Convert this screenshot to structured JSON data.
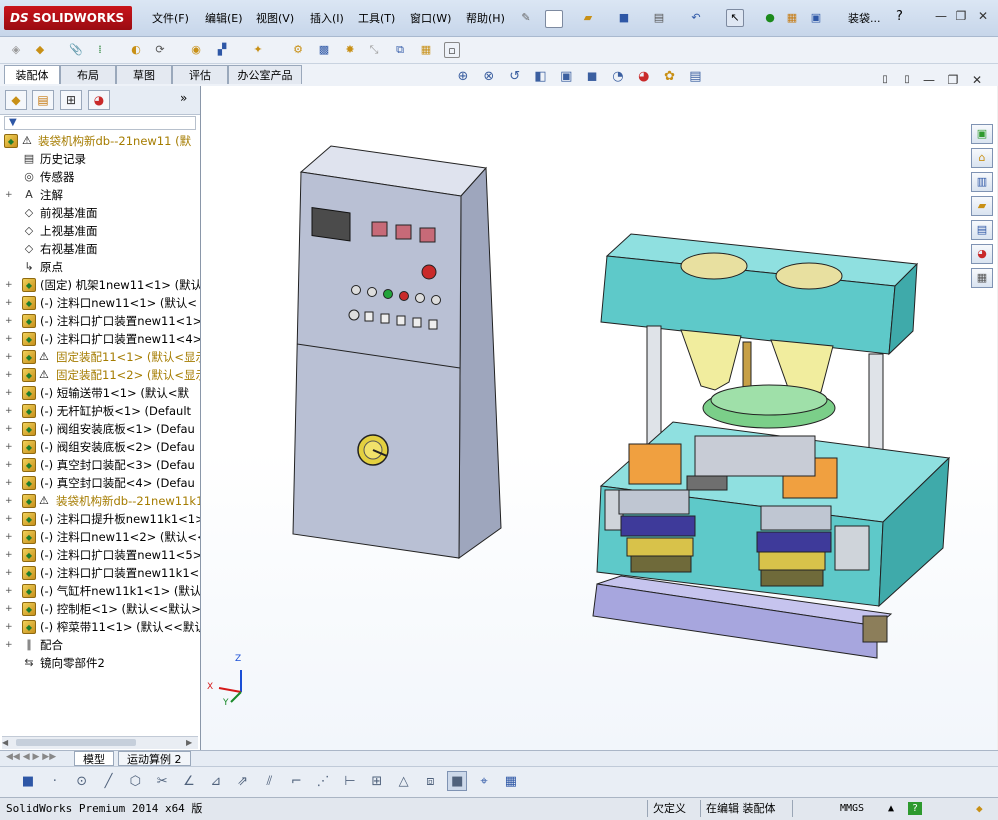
{
  "app": {
    "logo_brand": "SOLIDWORKS",
    "logo_ds": "DS",
    "doc_title": "装袋...",
    "help": "?"
  },
  "menu": [
    "文件(F)",
    "编辑(E)",
    "视图(V)",
    "插入(I)",
    "工具(T)",
    "窗口(W)",
    "帮助(H)"
  ],
  "command_tabs": [
    "装配体",
    "布局",
    "草图",
    "评估",
    "办公室产品"
  ],
  "feature_tree": {
    "filter_icon": "filter-icon",
    "rows": [
      {
        "label": "装袋机构新db--21new11  (默",
        "icon": "assembly-icon",
        "warn": true,
        "style": "yellow",
        "expand": false,
        "indent": 0
      },
      {
        "label": "历史记录",
        "icon": "history-icon",
        "warn": false,
        "style": "normal",
        "expand": false,
        "indent": 1
      },
      {
        "label": "传感器",
        "icon": "sensor-icon",
        "warn": false,
        "style": "normal",
        "expand": false,
        "indent": 1
      },
      {
        "label": "注解",
        "icon": "annotation-icon",
        "warn": false,
        "style": "normal",
        "expand": true,
        "indent": 1
      },
      {
        "label": "前视基准面",
        "icon": "plane-icon",
        "warn": false,
        "style": "normal",
        "expand": false,
        "indent": 1
      },
      {
        "label": "上视基准面",
        "icon": "plane-icon",
        "warn": false,
        "style": "normal",
        "expand": false,
        "indent": 1
      },
      {
        "label": "右视基准面",
        "icon": "plane-icon",
        "warn": false,
        "style": "normal",
        "expand": false,
        "indent": 1
      },
      {
        "label": "原点",
        "icon": "origin-icon",
        "warn": false,
        "style": "normal",
        "expand": false,
        "indent": 1
      },
      {
        "label": "(固定) 机架1new11<1> (默认",
        "icon": "part-icon",
        "warn": false,
        "style": "normal",
        "expand": true,
        "indent": 1
      },
      {
        "label": "(-) 注料口new11<1> (默认<",
        "icon": "part-icon",
        "warn": false,
        "style": "normal",
        "expand": true,
        "indent": 1
      },
      {
        "label": "(-) 注料口扩口装置new11<1>",
        "icon": "part-icon",
        "warn": false,
        "style": "normal",
        "expand": true,
        "indent": 1
      },
      {
        "label": "(-) 注料口扩口装置new11<4>",
        "icon": "part-icon",
        "warn": false,
        "style": "normal",
        "expand": true,
        "indent": 1
      },
      {
        "label": "固定装配11<1> (默认<显示",
        "icon": "assembly-icon",
        "warn": true,
        "style": "yellow",
        "expand": true,
        "indent": 1
      },
      {
        "label": "固定装配11<2> (默认<显示",
        "icon": "assembly-icon",
        "warn": true,
        "style": "yellow",
        "expand": true,
        "indent": 1
      },
      {
        "label": "(-) 短输送带1<1> (默认<默",
        "icon": "part-icon",
        "warn": false,
        "style": "normal",
        "expand": true,
        "indent": 1
      },
      {
        "label": "(-) 无杆缸护板<1> (Default",
        "icon": "part-icon",
        "warn": false,
        "style": "normal",
        "expand": true,
        "indent": 1
      },
      {
        "label": "(-) 阀组安装底板<1> (Defau",
        "icon": "part-icon",
        "warn": false,
        "style": "normal",
        "expand": true,
        "indent": 1
      },
      {
        "label": "(-) 阀组安装底板<2> (Defau",
        "icon": "part-icon",
        "warn": false,
        "style": "normal",
        "expand": true,
        "indent": 1
      },
      {
        "label": "(-) 真空封口装配<3> (Defau",
        "icon": "part-icon",
        "warn": false,
        "style": "normal",
        "expand": true,
        "indent": 1
      },
      {
        "label": "(-) 真空封口装配<4> (Defau",
        "icon": "part-icon",
        "warn": false,
        "style": "normal",
        "expand": true,
        "indent": 1
      },
      {
        "label": "装袋机构新db--21new11k1",
        "icon": "assembly-icon",
        "warn": true,
        "style": "yellow",
        "expand": true,
        "indent": 1
      },
      {
        "label": "(-) 注料口提升板new11k1<1>",
        "icon": "part-icon",
        "warn": false,
        "style": "normal",
        "expand": true,
        "indent": 1
      },
      {
        "label": "(-) 注料口new11<2> (默认<<",
        "icon": "part-icon",
        "warn": false,
        "style": "normal",
        "expand": true,
        "indent": 1
      },
      {
        "label": "(-) 注料口扩口装置new11<5>",
        "icon": "part-icon",
        "warn": false,
        "style": "normal",
        "expand": true,
        "indent": 1
      },
      {
        "label": "(-) 注料口扩口装置new11k1<",
        "icon": "part-icon",
        "warn": false,
        "style": "normal",
        "expand": true,
        "indent": 1
      },
      {
        "label": "(-) 气缸杆new11k1<1> (默认",
        "icon": "part-icon",
        "warn": false,
        "style": "normal",
        "expand": true,
        "indent": 1
      },
      {
        "label": "(-) 控制柜<1> (默认<<默认>",
        "icon": "part-icon",
        "warn": false,
        "style": "normal",
        "expand": true,
        "indent": 1
      },
      {
        "label": "(-) 榨菜带11<1> (默认<<默认",
        "icon": "part-icon",
        "warn": false,
        "style": "normal",
        "expand": true,
        "indent": 1
      },
      {
        "label": "配合",
        "icon": "mates-icon",
        "warn": false,
        "style": "normal",
        "expand": true,
        "indent": 1
      },
      {
        "label": "镜向零部件2",
        "icon": "mirror-icon",
        "warn": false,
        "style": "normal",
        "expand": false,
        "indent": 1
      }
    ]
  },
  "triad": {
    "x": "X",
    "y": "Y",
    "z": "Z"
  },
  "bottom_tabs": [
    "模型",
    "运动算例 2"
  ],
  "status": {
    "product": "SolidWorks Premium 2014 x64 版",
    "underdefined": "欠定义",
    "editing": "在编辑 装配体",
    "units": "MMGS",
    "help": "?"
  },
  "colors": {
    "machine_teal": "#5ec9c9",
    "cabinet_gray": "#b9c0d4",
    "conveyor_purple": "#a7a6de",
    "hopper_yellow": "#f1ed9e",
    "light_red": "#c92a2a"
  }
}
